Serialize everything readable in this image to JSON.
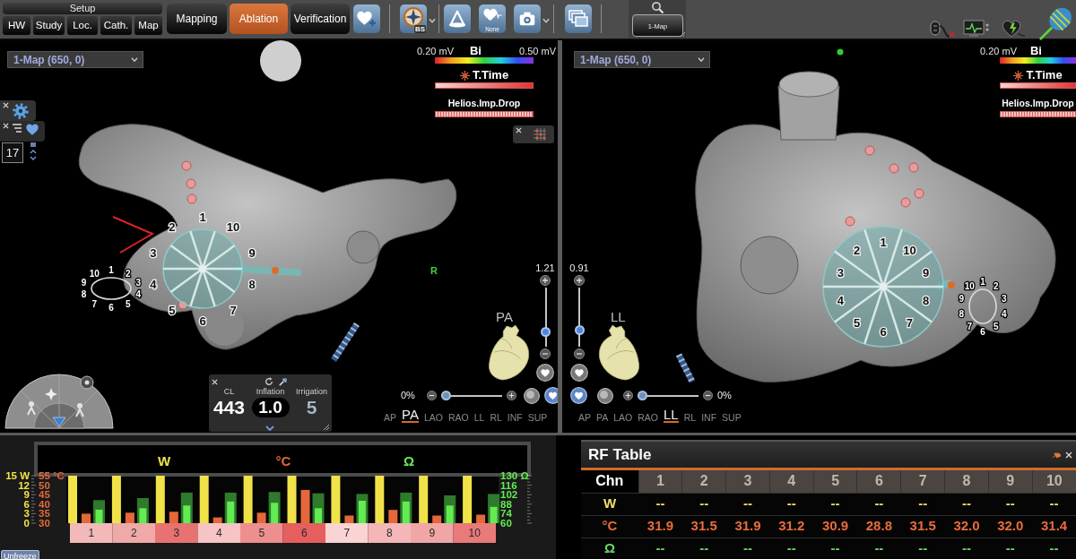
{
  "toolbar": {
    "setup": {
      "title": "Setup",
      "buttons": [
        "HW",
        "Study",
        "Loc.",
        "Cath.",
        "Map"
      ]
    },
    "workflow": [
      {
        "label": "Mapping",
        "selected": false
      },
      {
        "label": "Ablation",
        "selected": true
      },
      {
        "label": "Verification",
        "selected": false
      }
    ],
    "compass_badge": "BS",
    "cardiac_label": "None",
    "map_button": "1-Map"
  },
  "views": [
    {
      "map_select": "1-Map (650, 0)",
      "legend": {
        "min": "0.20 mV",
        "title": "Bi",
        "max": "0.50 mV",
        "tag_title": "T.Time",
        "drop_title": "Helios.Imp.Drop"
      },
      "marker": "R",
      "zoom": {
        "reading": "1.21",
        "level": 0.2
      },
      "orientation": "PA",
      "opacity": {
        "reading": "0%",
        "level": 0
      },
      "directions": [
        {
          "label": "AP",
          "selected": false
        },
        {
          "label": "PA",
          "selected": true
        },
        {
          "label": "LAO",
          "selected": false
        },
        {
          "label": "RAO",
          "selected": false
        },
        {
          "label": "LL",
          "selected": false
        },
        {
          "label": "RL",
          "selected": false
        },
        {
          "label": "INF",
          "selected": false
        },
        {
          "label": "SUP",
          "selected": false
        }
      ],
      "balloon_electrodes": [
        "1",
        "2",
        "3",
        "4",
        "5",
        "6",
        "7",
        "8",
        "9",
        "10"
      ],
      "lasso_electrodes": [
        "1",
        "2",
        "3",
        "4",
        "5",
        "6",
        "7",
        "8",
        "9",
        "10"
      ]
    },
    {
      "map_select": "1-Map (650, 0)",
      "legend": {
        "min": "0.20 mV",
        "title": "Bi",
        "tag_title": "T.Time",
        "drop_title": "Helios.Imp.Drop"
      },
      "zoom": {
        "reading": "0.91",
        "level": 0.23
      },
      "orientation": "LL",
      "opacity": {
        "reading": "0%",
        "level": 0
      },
      "directions": [
        {
          "label": "AP",
          "selected": false
        },
        {
          "label": "PA",
          "selected": false
        },
        {
          "label": "LAO",
          "selected": false
        },
        {
          "label": "RAO",
          "selected": false
        },
        {
          "label": "LL",
          "selected": true
        },
        {
          "label": "RL",
          "selected": false
        },
        {
          "label": "INF",
          "selected": false
        },
        {
          "label": "SUP",
          "selected": false
        }
      ],
      "balloon_electrodes": [
        "1",
        "2",
        "3",
        "4",
        "5",
        "6",
        "7",
        "8",
        "9",
        "10"
      ],
      "lasso_electrodes": [
        "1",
        "2",
        "3",
        "4",
        "5",
        "6",
        "7",
        "8",
        "9",
        "10"
      ]
    }
  ],
  "counter": "17",
  "ablation_panel": [
    {
      "kind": "plain",
      "label": "CL",
      "value": "443"
    },
    {
      "kind": "pill",
      "label": "Inflation",
      "value": "1.0"
    },
    {
      "kind": "muted",
      "label": "Irrigation",
      "value": "5"
    }
  ],
  "rf_chart": {
    "charts": [
      {
        "chart_data": {
          "type": "bar",
          "categories": [
            "1",
            "2",
            "3",
            "4",
            "5",
            "6",
            "7",
            "8",
            "9",
            "10"
          ],
          "series": [
            {
              "name": "W",
              "color": "#f2e24a",
              "values": [
                15,
                15,
                15,
                15,
                15,
                15,
                15,
                15,
                15,
                15
              ]
            }
          ],
          "ylim": [
            0,
            15
          ],
          "yticks": [
            0,
            3,
            6,
            9,
            12,
            {
              "value": 15,
              "label": "15 W"
            }
          ]
        }
      },
      {
        "chart_data": {
          "type": "bar",
          "series": [
            {
              "name": "°C",
              "color": "#e4683a",
              "values": [
                35,
                35.5,
                36,
                33,
                35.5,
                47.5,
                34,
                37,
                34,
                34.5
              ]
            }
          ],
          "ylim": [
            30,
            55
          ],
          "yticks": [
            30,
            35,
            40,
            45,
            50,
            {
              "value": 55,
              "label": "55 °C"
            }
          ]
        }
      },
      {
        "chart_data": {
          "type": "bar",
          "series": [
            {
              "name": "Ω",
              "color": "#62ec52",
              "values": [
                80,
                82,
                86,
                92,
                90,
                82,
                93,
                92,
                86,
                84
              ]
            },
            {
              "color": "#2f7a2c",
              "values": [
                94,
                97,
                105,
                105,
                106,
                104,
                103,
                105,
                101,
                103
              ]
            }
          ],
          "ylim": [
            60,
            130
          ],
          "yticks": [
            60,
            74,
            88,
            102,
            116,
            {
              "value": 130,
              "label": "130 Ω"
            }
          ]
        }
      }
    ],
    "channels": [
      {
        "color": "#f3b9b9"
      },
      {
        "color": "#f0a9a9"
      },
      {
        "color": "#e87272"
      },
      {
        "color": "#f6c4c4"
      },
      {
        "color": "#ee8f8f"
      },
      {
        "color": "#e65f5f"
      },
      {
        "color": "#fad3d3"
      },
      {
        "color": "#f4b6b6"
      },
      {
        "color": "#f1a6a6"
      },
      {
        "color": "#e97a7a"
      }
    ]
  },
  "unfreeze": "Unfreeze",
  "rf_table": {
    "title": "RF Table",
    "columns": [
      "Chn",
      "1",
      "2",
      "3",
      "4",
      "5",
      "6",
      "7",
      "8",
      "9",
      "10"
    ],
    "rows": [
      {
        "color": "#eee06a",
        "cells": [
          "W",
          "--",
          "--",
          "--",
          "--",
          "--",
          "--",
          "--",
          "--",
          "--",
          "--"
        ]
      },
      {
        "color": "#ea6c3c",
        "cells": [
          "°C",
          "31.9",
          "31.5",
          "31.9",
          "31.2",
          "30.9",
          "28.8",
          "31.5",
          "32.0",
          "32.0",
          "31.4"
        ]
      },
      {
        "color": "#6ad66a",
        "cells": [
          "Ω",
          "--",
          "--",
          "--",
          "--",
          "--",
          "--",
          "--",
          "--",
          "--",
          "--"
        ]
      }
    ]
  }
}
